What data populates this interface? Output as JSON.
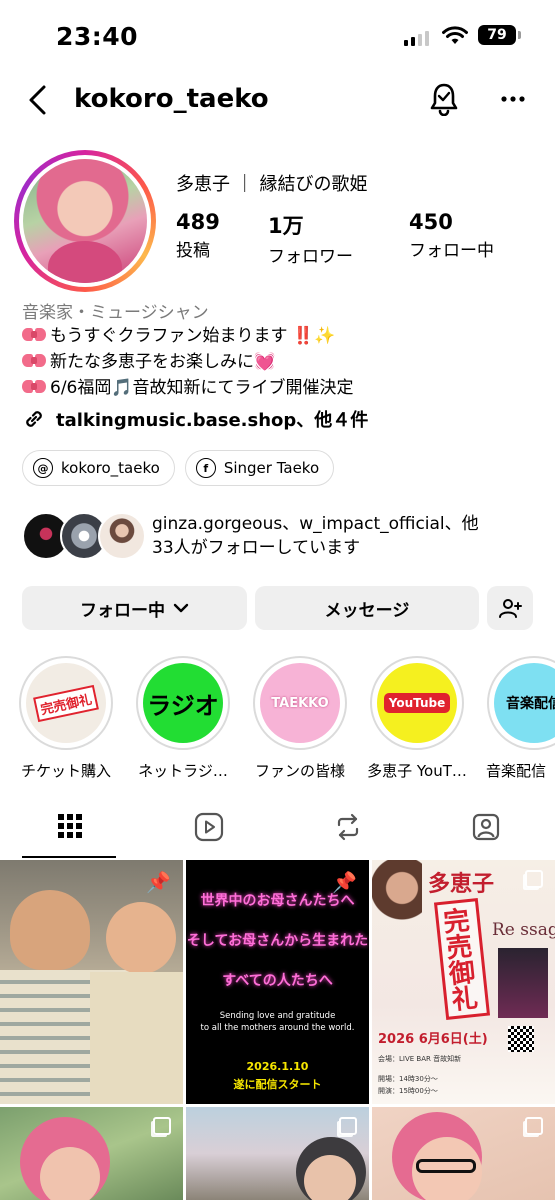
{
  "status_bar": {
    "time": "23:40",
    "battery": "79"
  },
  "header": {
    "username": "kokoro_taeko"
  },
  "profile": {
    "display_name": "多恵子 ｜ 縁結びの歌姫",
    "stats": [
      {
        "value": "489",
        "label": "投稿"
      },
      {
        "value": "1万",
        "label": "フォロワー"
      },
      {
        "value": "450",
        "label": "フォロー中"
      }
    ]
  },
  "bio": {
    "category": "音楽家・ミュージシャン",
    "line1": "もうすぐクラファン始まります",
    "line1_bangs": "‼️",
    "line1_spark": "✨",
    "line2": "新たな多恵子をお楽しみに",
    "line2_heart": "💓",
    "line3_pre": "6/6福岡",
    "line3_note": "🎵",
    "line3_post": "音故知新にてライブ開催決定",
    "link": "talkingmusic.base.shop、他４件"
  },
  "chips": [
    {
      "icon": "threads-icon",
      "label": "kokoro_taeko"
    },
    {
      "icon": "facebook-icon",
      "label": "Singer Taeko"
    }
  ],
  "followed_by": {
    "line1": "ginza.gorgeous、w_impact_official、他",
    "line2": "33人がフォローしています"
  },
  "buttons": {
    "following": "フォロー中",
    "message": "メッセージ"
  },
  "highlights": [
    {
      "label": "チケット購入",
      "cover_text": "完売御礼",
      "color": "#f2f2f2"
    },
    {
      "label": "ネットラジ…",
      "cover_text": "ラジオ",
      "color": "#22dd33"
    },
    {
      "label": "ファンの皆様",
      "cover_text": "TAEKKO",
      "color": "#f7b3d6"
    },
    {
      "label": "多恵子 YouT…",
      "cover_text": "YouTube",
      "color": "#f5f01f"
    },
    {
      "label": "音楽配信",
      "cover_text": "音楽配信",
      "color": "#7ee0f2"
    }
  ],
  "posts": {
    "post2": {
      "line1": "世界中のお母さんたちへ",
      "line2": "そしてお母さんから生まれた",
      "line3": "すべての人たちへ",
      "english1": "Sending love and gratitude",
      "english2": "to all the mothers around the world.",
      "date": "2026.1.10",
      "date2": "遂に配信スタート"
    },
    "post3": {
      "name": "多恵子",
      "stamp": "完売御礼",
      "title": "Re ssage",
      "date": "2026 6月6日(土)",
      "venue": "会場：LIVE BAR 音故知新",
      "open": "開場：14時30分～",
      "start": "開演：15時00分～"
    }
  },
  "colors": {
    "accent_grey": "#efefef",
    "highlight_ring": "#dbdbdb",
    "bangs": "#e0232e"
  }
}
